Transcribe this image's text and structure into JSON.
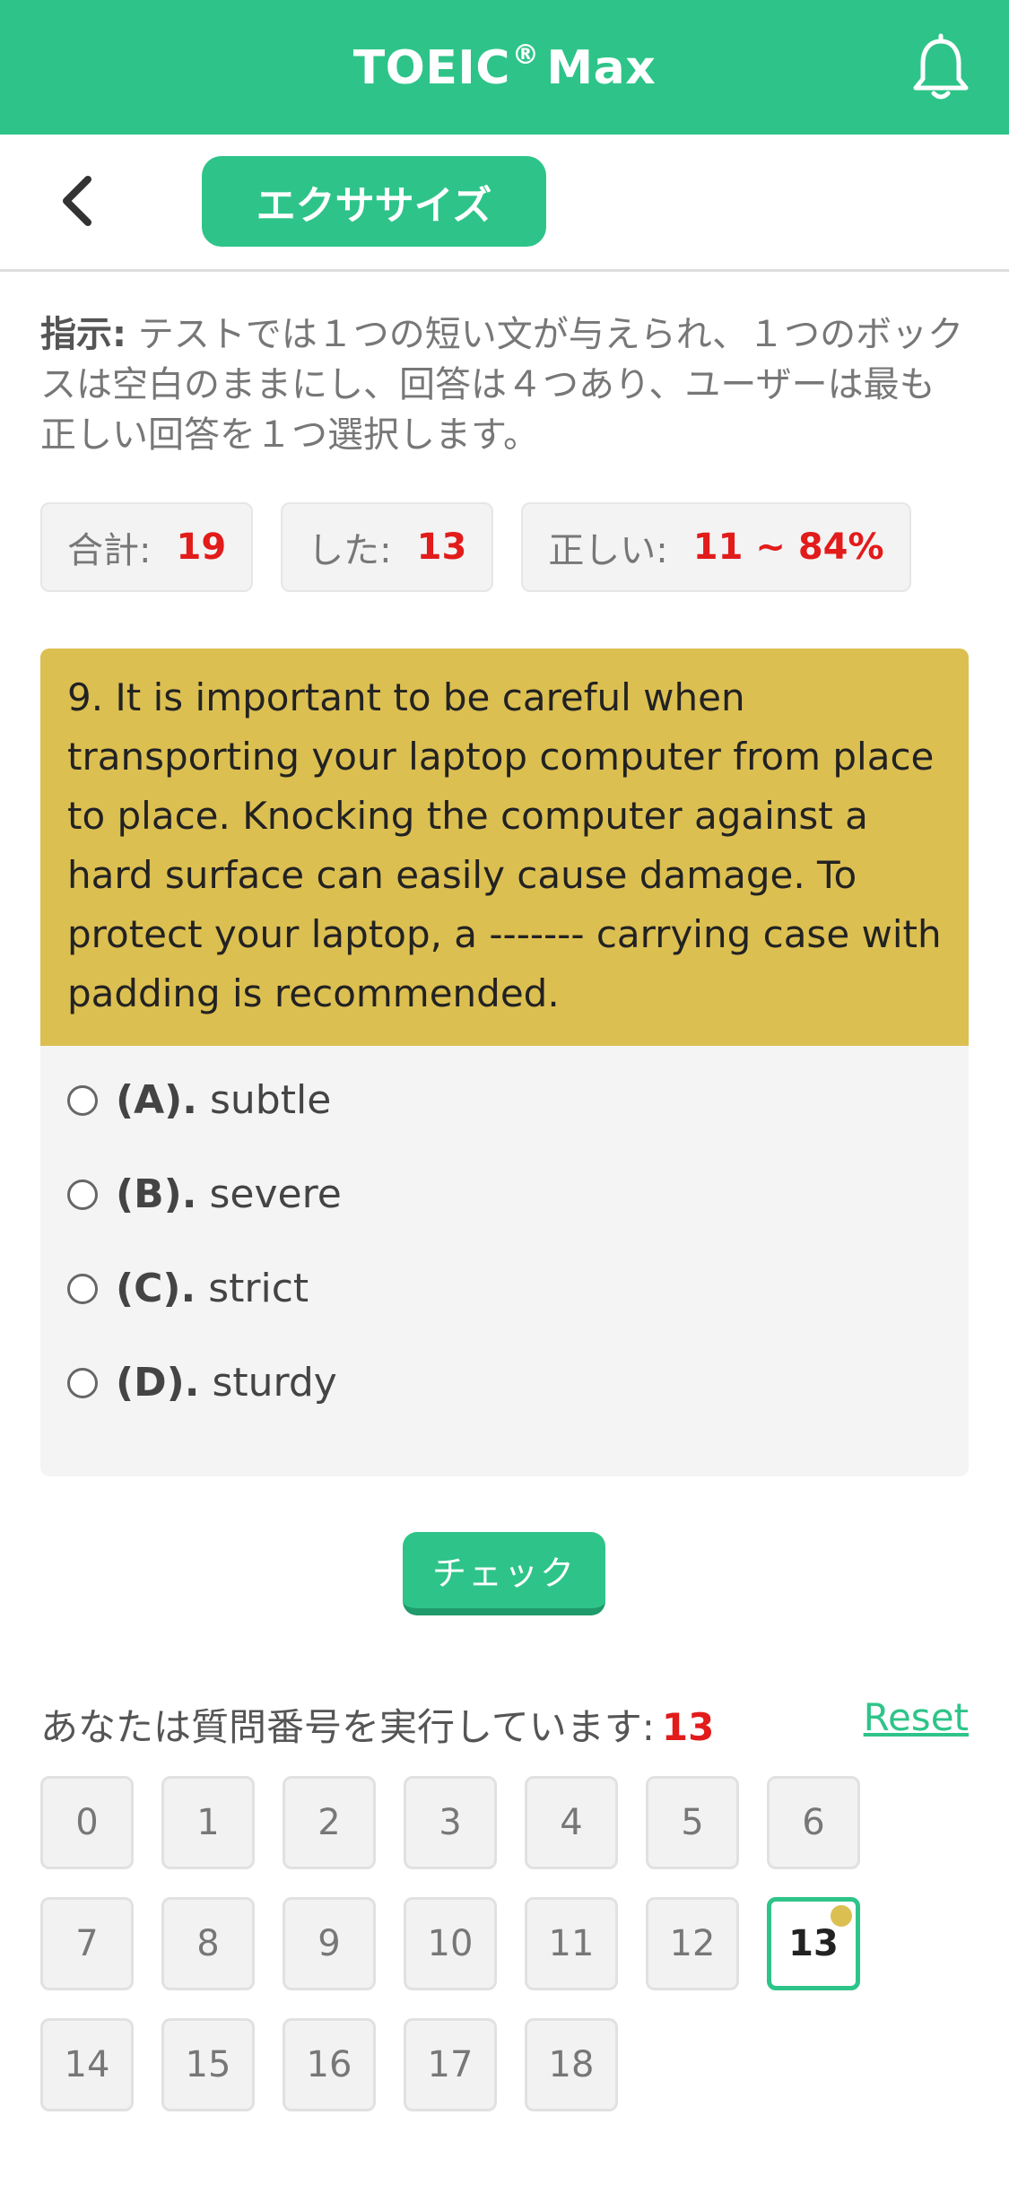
{
  "header": {
    "title": "TOEIC",
    "title_mark": "®",
    "title_suffix": "Max",
    "bell_icon": "bell-icon"
  },
  "subheader": {
    "back_icon": "chevron-left-icon",
    "tab_label": "エクササイズ"
  },
  "instruction": {
    "label": "指示:",
    "text": "テストでは１つの短い文が与えられ、１つのボックスは空白のままにし、回答は４つあり、ユーザーは最も正しい回答を１つ選択します。"
  },
  "stats": {
    "total_label": "合計:",
    "total_value": "19",
    "done_label": "した:",
    "done_value": "13",
    "correct_label": "正しい:",
    "correct_value": "11 ~ 84%"
  },
  "question": {
    "text": "9. It is important to be careful when transporting your laptop computer from place to place. Knocking the computer against a hard surface can easily cause damage. To protect your laptop, a ------- carrying case with padding is recommended.",
    "options": [
      {
        "key": "(A).",
        "text": "subtle"
      },
      {
        "key": "(B).",
        "text": "severe"
      },
      {
        "key": "(C).",
        "text": "strict"
      },
      {
        "key": "(D).",
        "text": "sturdy"
      }
    ]
  },
  "check_button": "チェック",
  "progress": {
    "label": "あなたは質問番号を実行しています:",
    "current": "13",
    "reset_label": "Reset",
    "numbers": [
      "0",
      "1",
      "2",
      "3",
      "4",
      "5",
      "6",
      "7",
      "8",
      "9",
      "10",
      "11",
      "12",
      "13",
      "14",
      "15",
      "16",
      "17",
      "18"
    ]
  },
  "colors": {
    "accent": "#2ec489",
    "question_bg": "#dcbf51",
    "highlight": "#e21b1b"
  }
}
